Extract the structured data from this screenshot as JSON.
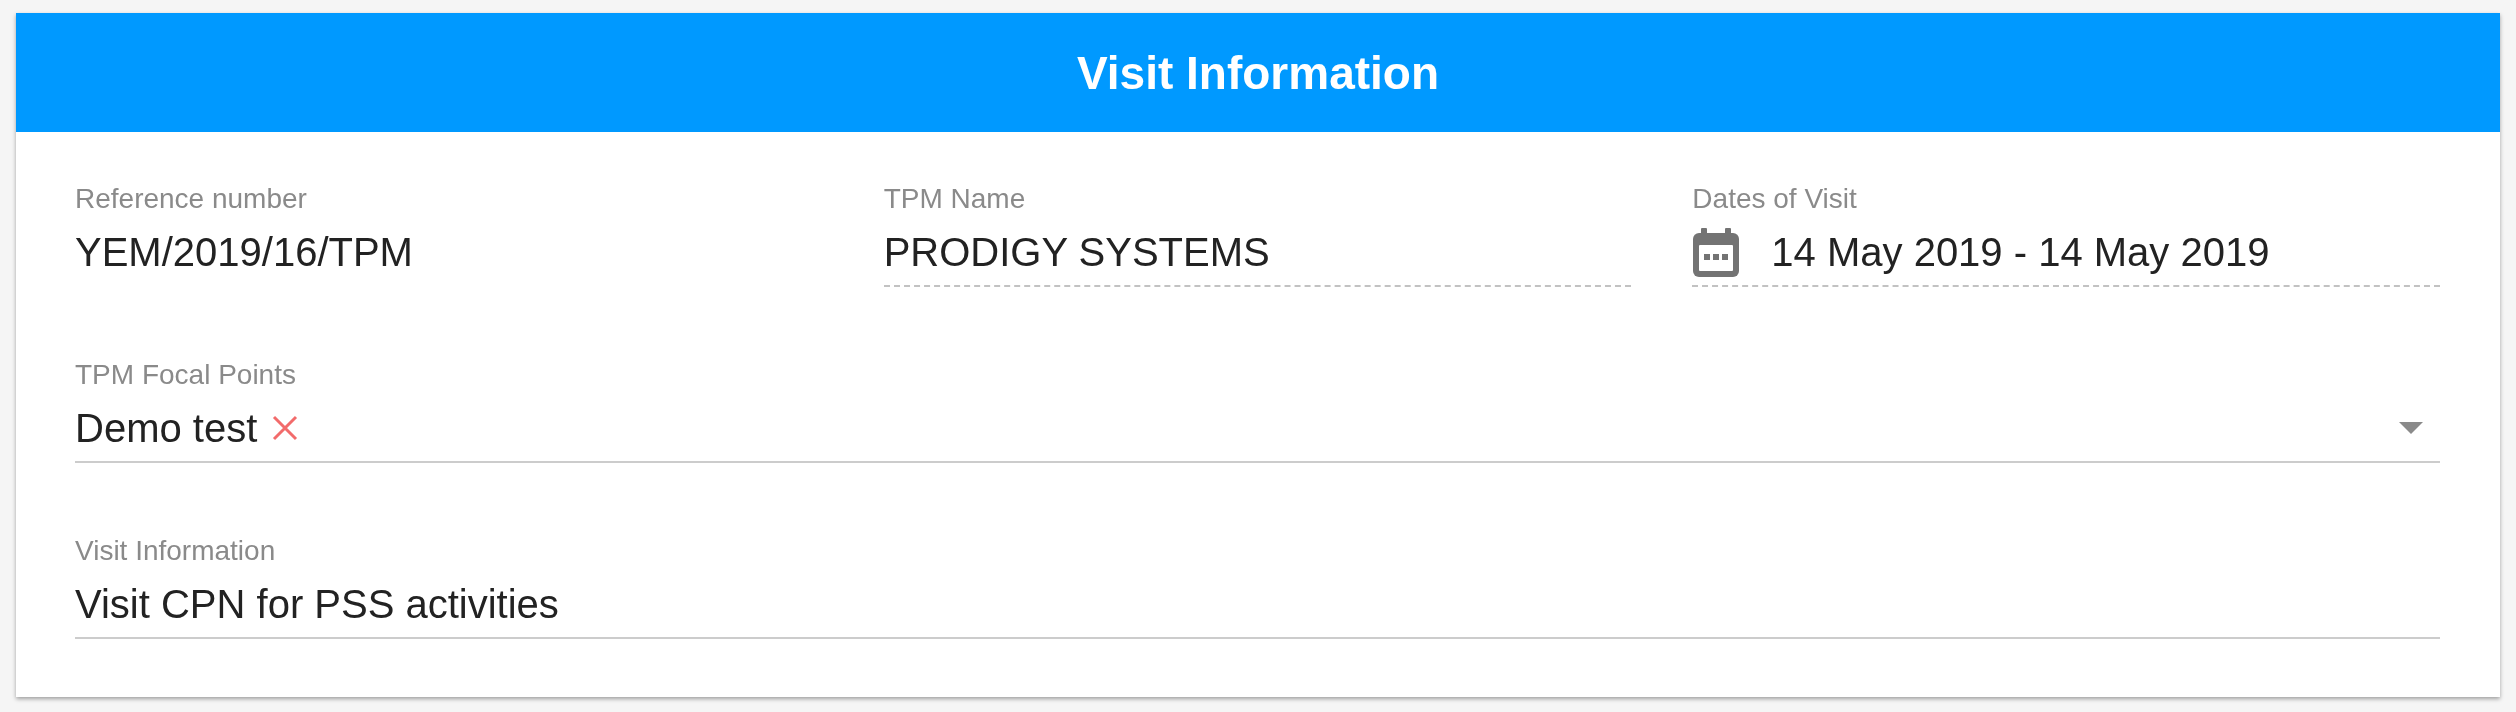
{
  "card": {
    "title": "Visit Information"
  },
  "rows": [
    {
      "fields": [
        {
          "kind": "plain",
          "label": "Reference number",
          "value": "YEM/2019/16/TPM"
        },
        {
          "kind": "text",
          "label": "TPM Name",
          "value": "PRODIGY SYSTEMS",
          "disabled": true
        },
        {
          "kind": "date",
          "label": "Dates of Visit",
          "value": "14 May 2019 - 14 May 2019",
          "disabled": true
        }
      ]
    },
    {
      "fields": [
        {
          "kind": "select",
          "label": "TPM Focal Points",
          "chips": [
            "Demo test"
          ],
          "disabled": false
        }
      ]
    },
    {
      "fields": [
        {
          "kind": "text",
          "label": "Visit Information",
          "value": "Visit CPN for PSS activities",
          "disabled": false
        }
      ]
    }
  ]
}
